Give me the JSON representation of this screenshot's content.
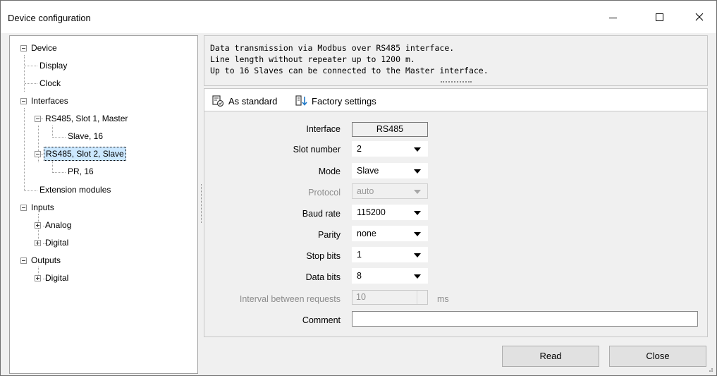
{
  "window": {
    "title": "Device configuration"
  },
  "tree": {
    "device": "Device",
    "display": "Display",
    "clock": "Clock",
    "interfaces": "Interfaces",
    "rs485_slot1": "RS485, Slot 1, Master",
    "slave16": "Slave, 16",
    "rs485_slot2": "RS485, Slot 2, Slave",
    "pr16": "PR, 16",
    "extension_modules": "Extension modules",
    "inputs": "Inputs",
    "analog": "Analog",
    "digital_in": "Digital",
    "outputs": "Outputs",
    "digital_out": "Digital"
  },
  "info": {
    "line1": "Data transmission via Modbus over RS485 interface.",
    "line2": "Line length without repeater up to 1200 m.",
    "line3": "Up to 16 Slaves can be connected to the Master interface."
  },
  "toolbar": {
    "as_standard": "As standard",
    "factory_settings": "Factory settings"
  },
  "form": {
    "interface_label": "Interface",
    "interface_value": "RS485",
    "slot_label": "Slot number",
    "slot_value": "2",
    "mode_label": "Mode",
    "mode_value": "Slave",
    "protocol_label": "Protocol",
    "protocol_value": "auto",
    "baud_label": "Baud rate",
    "baud_value": "115200",
    "parity_label": "Parity",
    "parity_value": "none",
    "stop_label": "Stop bits",
    "stop_value": "1",
    "data_label": "Data bits",
    "data_value": "8",
    "interval_label": "Interval between requests",
    "interval_value": "10",
    "interval_unit": "ms",
    "comment_label": "Comment",
    "comment_value": ""
  },
  "buttons": {
    "read": "Read",
    "close": "Close"
  }
}
